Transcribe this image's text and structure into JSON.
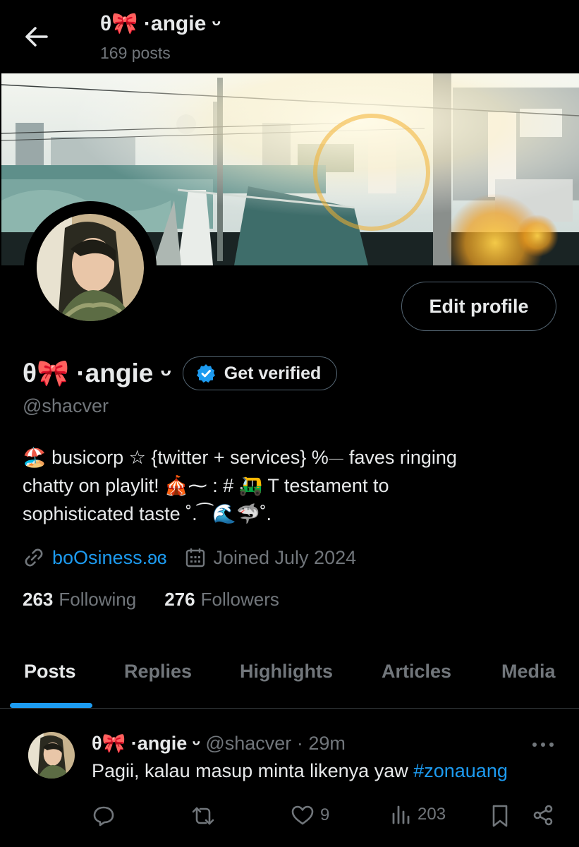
{
  "header": {
    "name": "θ🎀 ·angie ᵕ",
    "posts_count": "169 posts"
  },
  "profile": {
    "display_name": "θ🎀 ·angie ᵕ",
    "handle": "@shacver",
    "edit_label": "Edit profile",
    "verify_label": "Get verified",
    "bio_lines": [
      "🏖️  busicorp ☆ {twitter + services} %⏤  faves ringing",
      "chatty on playlit! 🎪⁓ : # 🛺  T testament to",
      "sophisticated taste ˚.⁀🌊🦈˚."
    ],
    "link": "boOsiness.ʚɞ",
    "joined": "Joined July 2024",
    "following_count": "263",
    "following_label": "Following",
    "followers_count": "276",
    "followers_label": "Followers"
  },
  "tabs": [
    "Posts",
    "Replies",
    "Highlights",
    "Articles",
    "Media"
  ],
  "tweet": {
    "name": "θ🎀 ·angie ᵕ",
    "handle": "@shacver",
    "dot": "·",
    "time": "29m",
    "text": "Pagii, kalau masup minta likenya yaw ",
    "hashtag": "#zonauang",
    "likes": "9",
    "views": "203"
  },
  "colors": {
    "accent": "#1d9bf0",
    "muted": "#71767b",
    "text": "#e7e9ea",
    "border": "#536471"
  }
}
